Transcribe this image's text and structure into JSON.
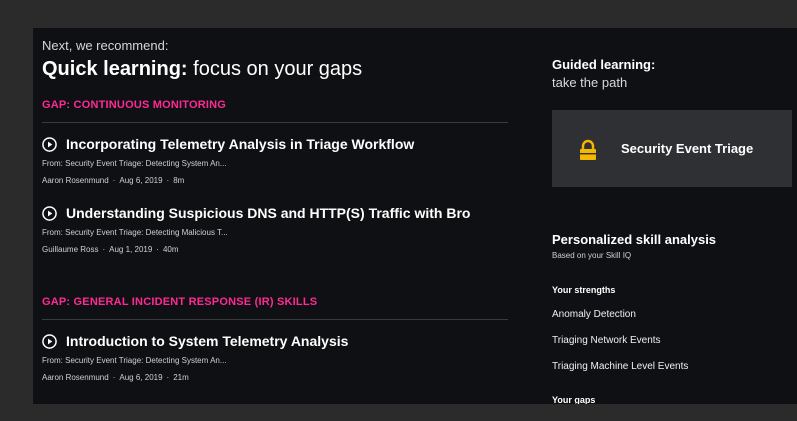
{
  "recommend": {
    "kicker": "Next, we recommend:",
    "headline_strong": "Quick learning:",
    "headline_light": "focus on your gaps"
  },
  "gaps": [
    {
      "label": "GAP: CONTINUOUS MONITORING",
      "courses": [
        {
          "title": "Incorporating Telemetry Analysis in Triage Workflow",
          "from": "From: Security Event Triage: Detecting System An...",
          "author": "Aaron Rosenmund",
          "date": "Aug 6, 2019",
          "duration": "8m"
        },
        {
          "title": "Understanding Suspicious DNS and HTTP(S) Traffic with Bro",
          "from": "From: Security Event Triage: Detecting Malicious T...",
          "author": "Guillaume Ross",
          "date": "Aug 1, 2019",
          "duration": "40m"
        }
      ]
    },
    {
      "label": "GAP: GENERAL INCIDENT RESPONSE (IR) SKILLS",
      "courses": [
        {
          "title": "Introduction to System Telemetry Analysis",
          "from": "From: Security Event Triage: Detecting System An...",
          "author": "Aaron Rosenmund",
          "date": "Aug 6, 2019",
          "duration": "21m"
        }
      ]
    }
  ],
  "guided": {
    "title": "Guided learning:",
    "subtitle": "take the path",
    "path_name": "Security Event Triage"
  },
  "skills": {
    "title": "Personalized skill analysis",
    "subtitle": "Based on your Skill IQ",
    "strengths_head": "Your strengths",
    "strengths": [
      "Anomaly Detection",
      "Triaging Network Events",
      "Triaging Machine Level Events"
    ],
    "gaps_head": "Your gaps"
  },
  "meta_separator": "·",
  "icons": {
    "course": "play-circle-icon",
    "path": "lock-icon"
  },
  "colors": {
    "accent": "#ff2a94",
    "lock": "#f5b800",
    "card": "#2e3033",
    "background": "#0f1013"
  }
}
